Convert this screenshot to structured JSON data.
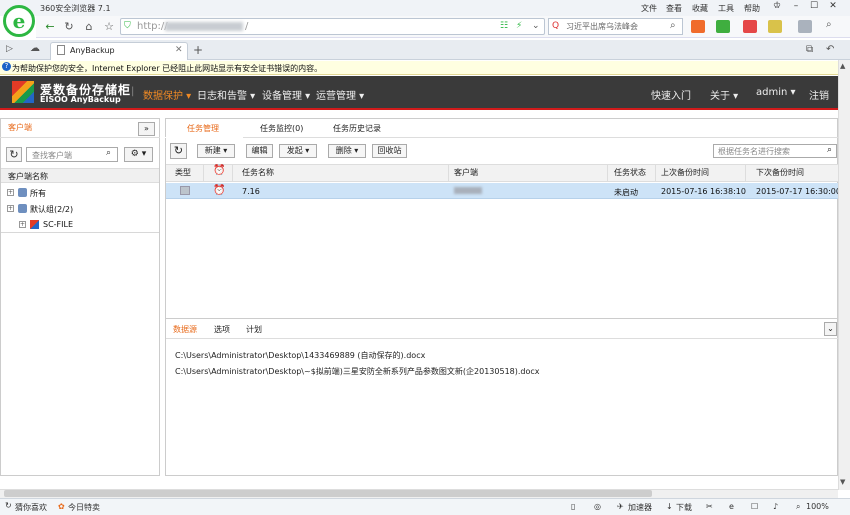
{
  "browser": {
    "title": "360安全浏览器 7.1",
    "menu": [
      "文件",
      "查看",
      "收藏",
      "工具",
      "帮助"
    ],
    "url_prefix": "http://",
    "url_suffix": "/",
    "search_text": "习近平出席乌法峰会",
    "tab_title": "AnyBackup",
    "info_bar": "为帮助保护您的安全，Internet Explorer 已经阻止此网站显示有安全证书错误的内容。",
    "bottom": {
      "left1": "猜你喜欢",
      "left2": "今日特卖",
      "accelerator": "加速器",
      "download": "下载",
      "zoom": "100%"
    }
  },
  "app": {
    "brand_cn": "爱数备份存储柜",
    "brand_en": "EISOO AnyBackup",
    "nav": [
      "数据保护",
      "日志和告警",
      "设备管理",
      "运营管理"
    ],
    "right_nav": [
      "快速入门",
      "关于",
      "admin",
      "注销"
    ],
    "left": {
      "tab": "客户端",
      "search_placeholder": "查找客户端",
      "column": "客户端名称",
      "tree": [
        "所有",
        "默认组(2/2)",
        "SC-FILE"
      ]
    },
    "tabs": [
      "任务管理",
      "任务监控(0)",
      "任务历史记录"
    ],
    "toolbar": [
      "新建",
      "编辑",
      "发起",
      "删除",
      "回收站"
    ],
    "search_placeholder": "根据任务名进行搜索",
    "grid": {
      "columns": [
        "类型",
        "任务名称",
        "客户端",
        "任务状态",
        "上次备份时间",
        "下次备份时间"
      ],
      "rows": [
        {
          "name": "7.16",
          "status": "未启动",
          "last": "2015-07-16 16:38:10",
          "next": "2015-07-17 16:30:00"
        }
      ]
    },
    "detail": {
      "tabs": [
        "数据源",
        "选项",
        "计划"
      ],
      "paths": [
        "C:\\Users\\Administrator\\Desktop\\1433469889 (自动保存的).docx",
        "C:\\Users\\Administrator\\Desktop\\~$拟前端)三星安防全新系列产品参数图文新(企20130518).docx"
      ]
    }
  }
}
